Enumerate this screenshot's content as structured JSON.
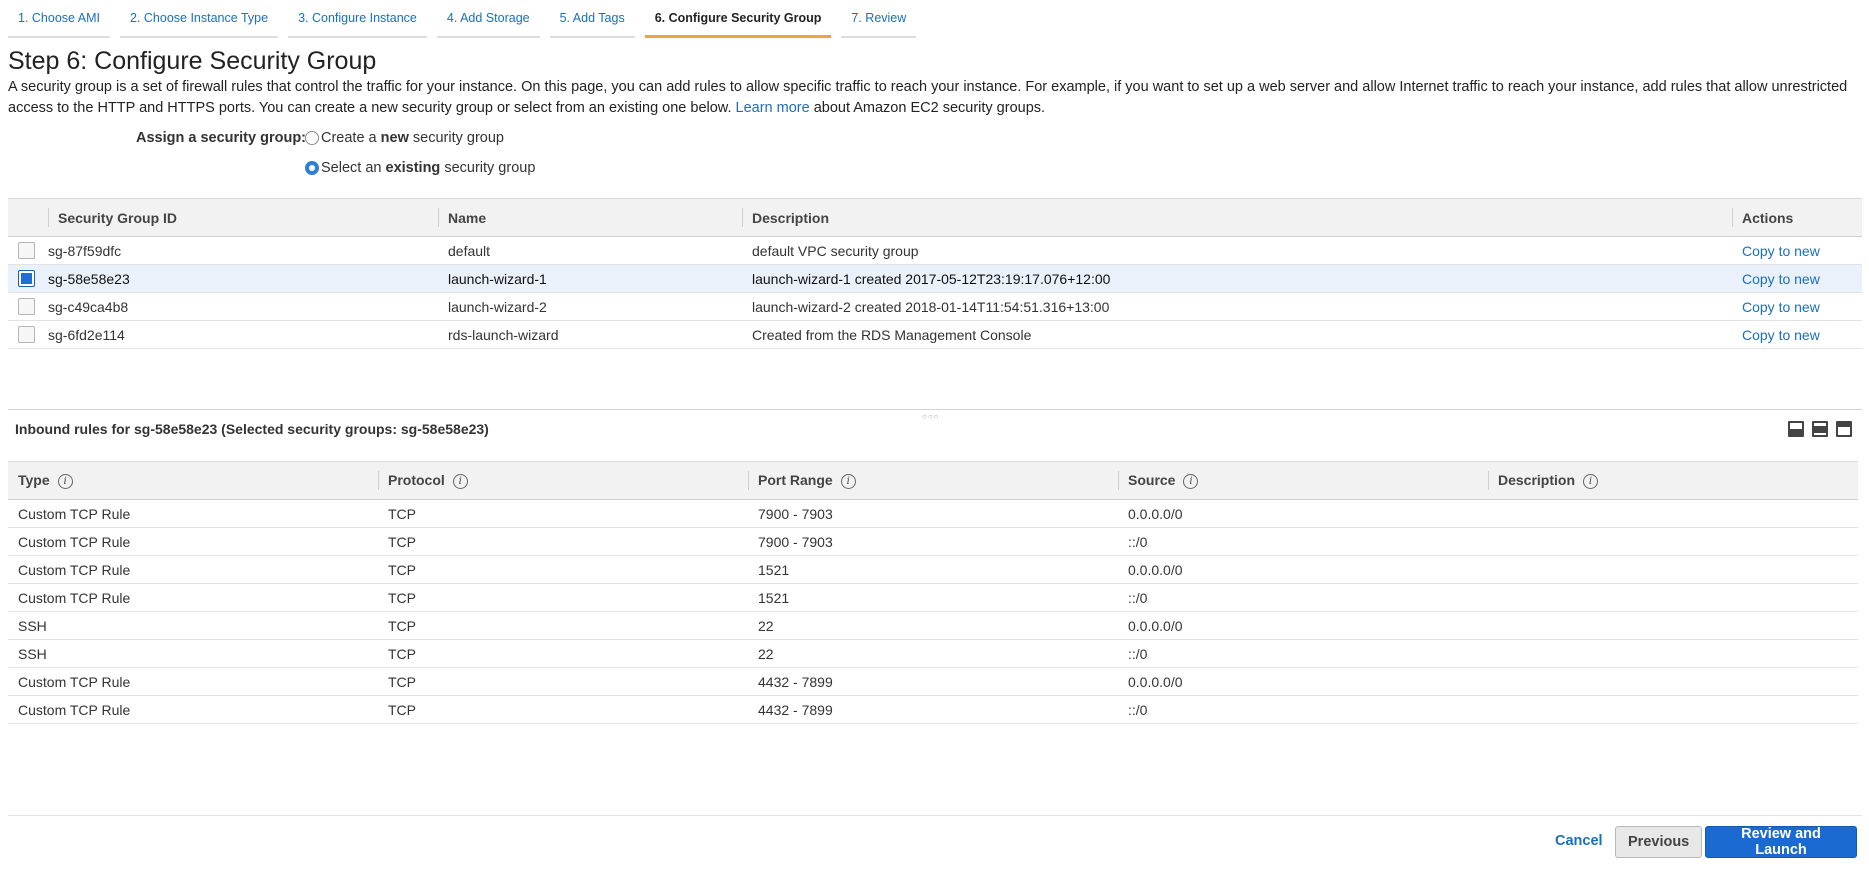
{
  "tabs": [
    {
      "label": "1. Choose AMI",
      "active": false
    },
    {
      "label": "2. Choose Instance Type",
      "active": false
    },
    {
      "label": "3. Configure Instance",
      "active": false
    },
    {
      "label": "4. Add Storage",
      "active": false
    },
    {
      "label": "5. Add Tags",
      "active": false
    },
    {
      "label": "6. Configure Security Group",
      "active": true
    },
    {
      "label": "7. Review",
      "active": false
    }
  ],
  "page": {
    "title": "Step 6: Configure Security Group",
    "intro_text": "A security group is a set of firewall rules that control the traffic for your instance. On this page, you can add rules to allow specific traffic to reach your instance. For example, if you want to set up a web server and allow Internet traffic to reach your instance, add rules that allow unrestricted access to the HTTP and HTTPS ports. You can create a new security group or select from an existing one below.",
    "learn_more": "Learn more",
    "intro_suffix": "about Amazon EC2 security groups."
  },
  "assign": {
    "label": "Assign a security group:",
    "create_prefix": "Create a ",
    "create_bold": "new",
    "create_suffix": " security group",
    "select_prefix": "Select an ",
    "select_bold": "existing",
    "select_suffix": " security group",
    "selected": "existing"
  },
  "sg_table": {
    "headers": {
      "id": "Security Group ID",
      "name": "Name",
      "description": "Description",
      "actions": "Actions"
    },
    "rows": [
      {
        "id": "sg-87f59dfc",
        "name": "default",
        "description": "default VPC security group",
        "action": "Copy to new",
        "selected": false
      },
      {
        "id": "sg-58e58e23",
        "name": "launch-wizard-1",
        "description": "launch-wizard-1 created 2017-05-12T23:19:17.076+12:00",
        "action": "Copy to new",
        "selected": true
      },
      {
        "id": "sg-c49ca4b8",
        "name": "launch-wizard-2",
        "description": "launch-wizard-2 created 2018-01-14T11:54:51.316+13:00",
        "action": "Copy to new",
        "selected": false
      },
      {
        "id": "sg-6fd2e114",
        "name": "rds-launch-wizard",
        "description": "Created from the RDS Management Console",
        "action": "Copy to new",
        "selected": false
      }
    ]
  },
  "inbound": {
    "title": "Inbound rules for sg-58e58e23 (Selected security groups: sg-58e58e23)",
    "headers": {
      "type": "Type",
      "protocol": "Protocol",
      "port_range": "Port Range",
      "source": "Source",
      "description": "Description"
    },
    "rows": [
      {
        "type": "Custom TCP Rule",
        "protocol": "TCP",
        "port_range": "7900 - 7903",
        "source": "0.0.0.0/0",
        "description": ""
      },
      {
        "type": "Custom TCP Rule",
        "protocol": "TCP",
        "port_range": "7900 - 7903",
        "source": "::/0",
        "description": ""
      },
      {
        "type": "Custom TCP Rule",
        "protocol": "TCP",
        "port_range": "1521",
        "source": "0.0.0.0/0",
        "description": ""
      },
      {
        "type": "Custom TCP Rule",
        "protocol": "TCP",
        "port_range": "1521",
        "source": "::/0",
        "description": ""
      },
      {
        "type": "SSH",
        "protocol": "TCP",
        "port_range": "22",
        "source": "0.0.0.0/0",
        "description": ""
      },
      {
        "type": "SSH",
        "protocol": "TCP",
        "port_range": "22",
        "source": "::/0",
        "description": ""
      },
      {
        "type": "Custom TCP Rule",
        "protocol": "TCP",
        "port_range": "4432 - 7899",
        "source": "0.0.0.0/0",
        "description": ""
      },
      {
        "type": "Custom TCP Rule",
        "protocol": "TCP",
        "port_range": "4432 - 7899",
        "source": "::/0",
        "description": ""
      }
    ]
  },
  "footer": {
    "cancel": "Cancel",
    "previous": "Previous",
    "review_launch": "Review and Launch"
  },
  "icons": {
    "info": "info-icon",
    "view_bottom": "panel-bottom-icon",
    "view_split": "panel-split-icon",
    "view_top": "panel-top-icon"
  },
  "colors": {
    "accent": "#1a6ad2",
    "link": "#1a6fbd",
    "active_tab_underline": "#f3a23d",
    "selected_row": "#eaf1fb"
  }
}
